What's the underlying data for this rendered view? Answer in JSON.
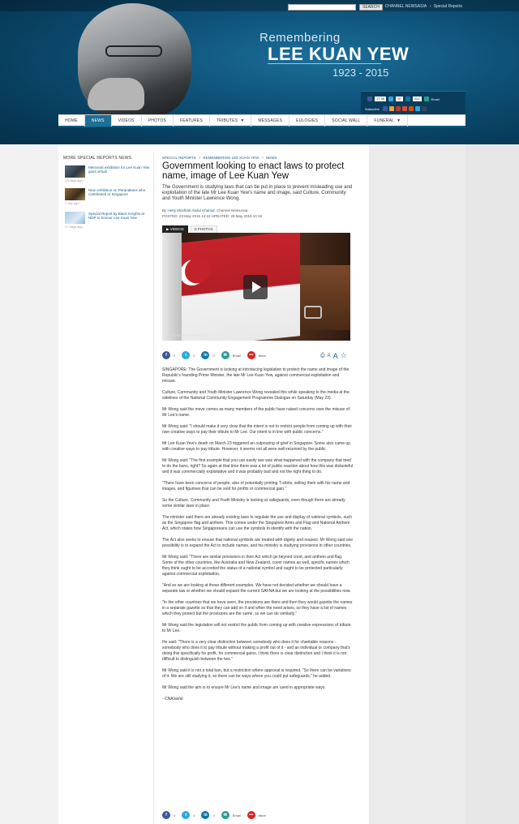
{
  "header": {
    "search_placeholder": "",
    "search_button": "SEARCH",
    "link_cna": "CHANNEL NEWSASIA",
    "link_special": "Special Reports",
    "remembering": "Remembering",
    "name": "LEE KUAN YEW",
    "years": "1923 - 2015",
    "share": {
      "fb_count": "17.3K",
      "tw_count": "57",
      "li_count": "221",
      "email_label": "Email",
      "subscribe_label": "Subscribe"
    }
  },
  "nav": [
    {
      "label": "HOME",
      "active": false
    },
    {
      "label": "NEWS",
      "active": true
    },
    {
      "label": "VIDEOS",
      "active": false
    },
    {
      "label": "PHOTOS",
      "active": false
    },
    {
      "label": "FEATURES",
      "active": false
    },
    {
      "label": "TRIBUTES",
      "active": false,
      "caret": true
    },
    {
      "label": "MESSAGES",
      "active": false
    },
    {
      "label": "EULOGIES",
      "active": false
    },
    {
      "label": "SOCIAL WALL",
      "active": false
    },
    {
      "label": "FUNERAL",
      "active": false,
      "caret": true
    }
  ],
  "sidebar": {
    "title": "MORE SPECIAL REPORTS NEWS",
    "items": [
      {
        "title": "Memorial exhibition for Lee Kuan Yew goes virtual",
        "time": "13 days ago"
      },
      {
        "title": "New exhibition on Peranakans who contributed to Singapore",
        "time": "1 day ago"
      },
      {
        "title": "Special Report by Black Knights at NDP to honour Lee Kuan Yew",
        "time": "27 days ago"
      }
    ]
  },
  "article": {
    "breadcrumb": [
      "SPECIAL REPORTS",
      "REMEMBERING LEE KUAN YEW",
      "NEWS"
    ],
    "headline": "Government looking to enact laws to protect name, image of Lee Kuan Yew",
    "standfirst": "The Government is studying laws that can be put in place to prevent misleading use and exploitation of the late Mr Lee Kuan Yew's name and image, said Culture, Community and Youth Minister Lawrence Wong.",
    "byline_prefix": "By",
    "byline_author": "Hetty Musfirah Abdul Khamid",
    "byline_suffix": ", Channel NewsAsia",
    "posted": "POSTED: 23 May 2015 14:22     UPDATED: 25 May 2015 10:19",
    "media_tabs": [
      "VIDEOS",
      "PHOTOS"
    ],
    "video_watermark": "CHANNEL NEWSASIA",
    "social": {
      "fb": "0",
      "tw": "0",
      "li": "0",
      "email": "Email",
      "more": "More"
    },
    "social_bottom": {
      "fb": "0",
      "tw": "0",
      "li": "0",
      "email": "Email",
      "more": "More"
    },
    "paragraphs": [
      "SINGAPORE: The Government is looking at introducing legislation to protect the name and image of the Republic's founding Prime Minister, the late Mr Lee Kuan Yew, against commercial exploitation and misuse.",
      "Culture, Community and Youth Minister Lawrence Wong revealed this while speaking to the media at the sidelines of the National Community Engagement Programme Dialogue on Saturday (May 23).",
      "Mr Wong said the move comes as many members of the public have raised concerns over the misuse of Mr Lee's name.",
      "Mr Wong said: \"I should make it very clear that the intent is not to restrict people from coming up with their own creative ways to pay their tribute to Mr Lee. Our intent is in line with public concerns.\"",
      "Mr Lee Kuan Yew's death on March 23 triggered an outpouring of grief in Singapore. Some also came up with creative ways to pay tribute. However, it seems not all were well-received by the public.",
      "Mr Wong said: \"The first example that you can easily see was what happened with the company that tried to do the buns, right? So again at that time there was a lot of public reaction about how this was distasteful and it was commercially exploitative and it was probably bad and not the right thing to do.",
      "\"There have been concerns of people, also of potentially printing T-shirts, selling them with his name and images, and figurines that can be sold for profits or commercial gain.\"",
      "So the Culture, Community and Youth Ministry is looking at safeguards, even though there are already some similar laws in place.",
      "The minister said there are already existing laws to regulate the use and display of national symbols, such as the Singapore flag and anthem. This comes under the Singapore Arms and Flag and National Anthem Act, which states how Singaporeans can use the symbols to identify with the nation.",
      "The Act also seeks to ensure that national symbols are treated with dignity and respect. Mr Wong said one possibility is to expand the Act to include names, and his ministry is studying provisions in other countries.",
      "Mr Wong said: \"There are similar provisions in their Act which go beyond crest, and anthem and flag. Some of the other countries, like Australia and New Zealand, cover names as well, specific names which they think ought to be accorded the status of a national symbol and ought to be protected particularly against commercial exploitation.",
      "\"And so we are looking at these different examples. We have not decided whether we should have a separate law or whether we should expand the current SAFNA but we are looking at the possibilities now.",
      "\"In the other countries that we have seen, the provisions are there and then they would gazette the names in a separate gazette so that they can add on if and when the need arises, so they have a list of names which they protect but the provisions are the same, so we can do similarly.\"",
      "Mr Wong said the legislation will not restrict the public from coming up with creative expressions of tribute to Mr Lee.",
      "He said: \"There is a very clear distinction between somebody who does it for charitable reasons - somebody who does it to pay tribute without making a profit out of it - and an individual or company that's doing this specifically for profit, for commercial gains. I think there is clear distinction and I think it is not difficult to distinguish between the two.\"",
      "Mr Wong said it is not a total ban, but a restriction where approval is required. \"So there can be variations of it. We are still studying it, so there can be ways where you could put safeguards,\" he added.",
      "Mr Wong said the aim is to ensure Mr Lee's name and image are used in appropriate ways.",
      "- CNA/av/al"
    ]
  },
  "colors": {
    "nav_active": "#1f6f97",
    "link": "#1a5f89",
    "fb": "#3b5998",
    "tw": "#2aa9e0",
    "li": "#0e76a8",
    "email": "#2a9d8f",
    "more": "#e02020"
  }
}
